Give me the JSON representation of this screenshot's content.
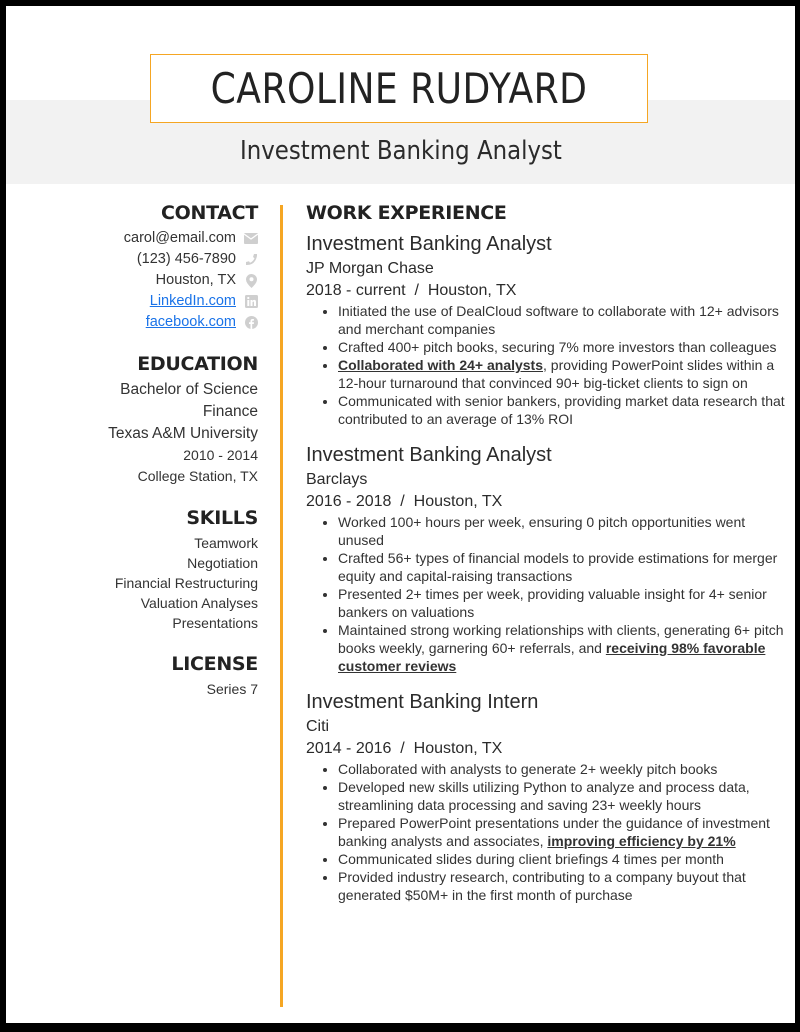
{
  "header": {
    "name": "CAROLINE RUDYARD",
    "title": "Investment Banking Analyst",
    "accent_color": "#f5a623"
  },
  "contact": {
    "heading": "CONTACT",
    "items": [
      {
        "text": "carol@email.com",
        "icon": "envelope-icon",
        "link": false
      },
      {
        "text": "(123) 456-7890",
        "icon": "phone-icon",
        "link": false
      },
      {
        "text": "Houston, TX",
        "icon": "map-pin-icon",
        "link": false
      },
      {
        "text": "LinkedIn.com",
        "icon": "linkedin-icon",
        "link": true
      },
      {
        "text": "facebook.com",
        "icon": "facebook-icon",
        "link": true
      }
    ]
  },
  "education": {
    "heading": "EDUCATION",
    "degree": "Bachelor of Science",
    "major": "Finance",
    "school": "Texas A&M University",
    "years": "2010 - 2014",
    "location": "College Station, TX"
  },
  "skills": {
    "heading": "SKILLS",
    "items": [
      "Teamwork",
      "Negotiation",
      "Financial Restructuring",
      "Valuation Analyses",
      "Presentations"
    ]
  },
  "license": {
    "heading": "LICENSE",
    "items": [
      "Series 7"
    ]
  },
  "work": {
    "heading": "WORK EXPERIENCE",
    "jobs": [
      {
        "title": "Investment Banking Analyst",
        "company": "JP Morgan Chase",
        "dates": "2018 - current  /  Houston, TX",
        "bullets": [
          {
            "bold": "",
            "text": "Initiated the use of DealCloud software to collaborate with 12+ advisors and merchant companies",
            "bold_after": ""
          },
          {
            "bold": "",
            "text": "Crafted 400+ pitch books, securing 7% more investors than colleagues",
            "bold_after": ""
          },
          {
            "bold": "Collaborated with 24+ analysts",
            "text": ", providing PowerPoint slides within a 12-hour turnaround that convinced 90+ big-ticket clients to sign on",
            "bold_after": ""
          },
          {
            "bold": "",
            "text": "Communicated with senior bankers, providing market data research that contributed to an average of 13% ROI",
            "bold_after": ""
          }
        ]
      },
      {
        "title": "Investment Banking Analyst",
        "company": "Barclays",
        "dates": "2016 - 2018  /  Houston, TX",
        "bullets": [
          {
            "bold": "",
            "text": "Worked 100+ hours per week, ensuring 0 pitch opportunities went unused",
            "bold_after": ""
          },
          {
            "bold": "",
            "text": "Crafted 56+ types of financial models to provide estimations for merger equity and capital-raising transactions",
            "bold_after": ""
          },
          {
            "bold": "",
            "text": "Presented 2+ times per week, providing valuable insight for 4+ senior bankers on valuations",
            "bold_after": ""
          },
          {
            "bold": "",
            "text": "Maintained strong working relationships with clients, generating 6+ pitch books weekly, garnering 60+ referrals, and ",
            "bold_after": "receiving 98% favorable customer reviews"
          }
        ]
      },
      {
        "title": "Investment Banking Intern",
        "company": "Citi",
        "dates": "2014 - 2016  /  Houston, TX",
        "bullets": [
          {
            "bold": "",
            "text": "Collaborated with analysts to generate 2+ weekly pitch books",
            "bold_after": ""
          },
          {
            "bold": "",
            "text": "Developed new skills utilizing Python to analyze and process data, streamlining data processing and saving 23+ weekly hours",
            "bold_after": ""
          },
          {
            "bold": "",
            "text": "Prepared PowerPoint presentations under the guidance of investment banking analysts and associates, ",
            "bold_after": "improving efficiency by 21%"
          },
          {
            "bold": "",
            "text": "Communicated slides during client briefings 4 times per month",
            "bold_after": ""
          },
          {
            "bold": "",
            "text": "Provided industry research, contributing to a company buyout that generated $50M+ in the first month of purchase",
            "bold_after": ""
          }
        ]
      }
    ]
  }
}
